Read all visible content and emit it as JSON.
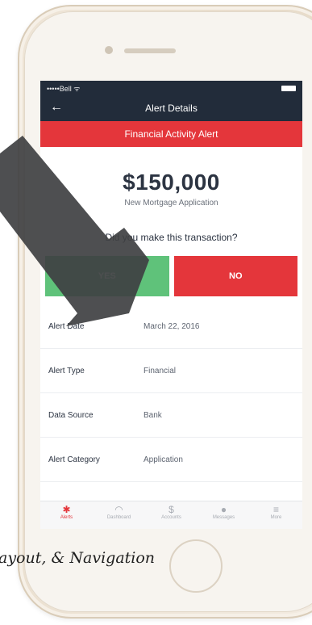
{
  "status_bar": {
    "carrier": "•••••Bell ᯤ"
  },
  "nav": {
    "title": "Alert Details",
    "back_icon": "back-arrow-icon"
  },
  "alert_banner": {
    "title": "Financial Activity Alert"
  },
  "summary": {
    "amount": "$150,000",
    "description": "New Mortgage Application",
    "question": "Did you make this transaction?"
  },
  "actions": {
    "yes_label": "YES",
    "no_label": "NO"
  },
  "details": [
    {
      "label": "Alert Date",
      "value": "March 22, 2016"
    },
    {
      "label": "Alert Type",
      "value": "Financial"
    },
    {
      "label": "Data Source",
      "value": "Bank"
    },
    {
      "label": "Alert Category",
      "value": "Application"
    }
  ],
  "tabs": [
    {
      "label": "Alerts",
      "icon": "alert-icon",
      "active": true
    },
    {
      "label": "Dashboard",
      "icon": "gauge-icon",
      "active": false
    },
    {
      "label": "Accounts",
      "icon": "dollar-icon",
      "active": false
    },
    {
      "label": "Messages",
      "icon": "chat-icon",
      "active": false
    },
    {
      "label": "More",
      "icon": "menu-icon",
      "active": false
    }
  ],
  "caption": "ayout, & Navigation",
  "colors": {
    "nav": "#222c3a",
    "accent_red": "#e4363b",
    "yes_green": "#5fc27a",
    "arrow": "#3f4042"
  }
}
